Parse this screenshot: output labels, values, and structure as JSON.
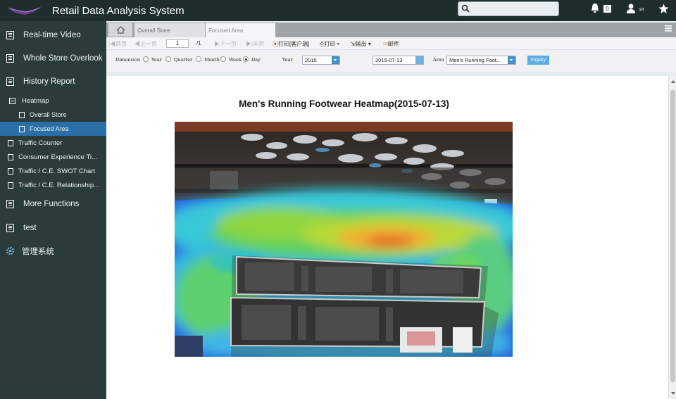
{
  "header": {
    "app_title": "Retail Data Analysis System",
    "notification_count": "0",
    "user_label": "sa",
    "accent_color": "#1f2d2d"
  },
  "sidebar": {
    "items": [
      {
        "label": "Real-time Video",
        "icon": "monitor-icon"
      },
      {
        "label": "Whole Store Overlook",
        "icon": "monitor-icon"
      },
      {
        "label": "History Report",
        "icon": "monitor-icon"
      },
      {
        "label": "Heatmap",
        "icon": "collapse-icon"
      },
      {
        "label": "Overall Store",
        "icon": "page-icon"
      },
      {
        "label": "Focused Area",
        "icon": "page-icon",
        "active": true
      },
      {
        "label": "Traffic Counter",
        "icon": "page-icon"
      },
      {
        "label": "Consumer Experience Ti...",
        "icon": "page-icon"
      },
      {
        "label": "Traffic / C.E. SWOT Chart",
        "icon": "page-icon"
      },
      {
        "label": "Traffic / C.E. Relationship...",
        "icon": "page-icon"
      },
      {
        "label": "More Functions",
        "icon": "monitor-icon"
      },
      {
        "label": "test",
        "icon": "monitor-icon"
      },
      {
        "label": "管理系统",
        "icon": "gear-icon"
      }
    ]
  },
  "tabs": [
    {
      "label": "Overall Store"
    },
    {
      "label": "Focused Area",
      "active": true
    }
  ],
  "toolbar": {
    "first": "首页",
    "prev": "上一页",
    "page": "1",
    "total": "/1",
    "next": "下一页",
    "last": "末页",
    "print_client": "打印[客户端]",
    "print": "打印",
    "export": "输出",
    "mail": "邮件"
  },
  "filters": {
    "dimension_label": "Dimension",
    "options": [
      "Year",
      "Quarter",
      "Month",
      "Week",
      "Day"
    ],
    "selected": "Day",
    "year_label": "Year",
    "year_value": "2015",
    "date_value": "2015-07-13",
    "area_label": "Area",
    "area_value": "Men's Running Foot...",
    "inquiry_label": "Inquiry"
  },
  "report": {
    "title": "Men's Running Footwear Heatmap(2015-07-13)"
  }
}
